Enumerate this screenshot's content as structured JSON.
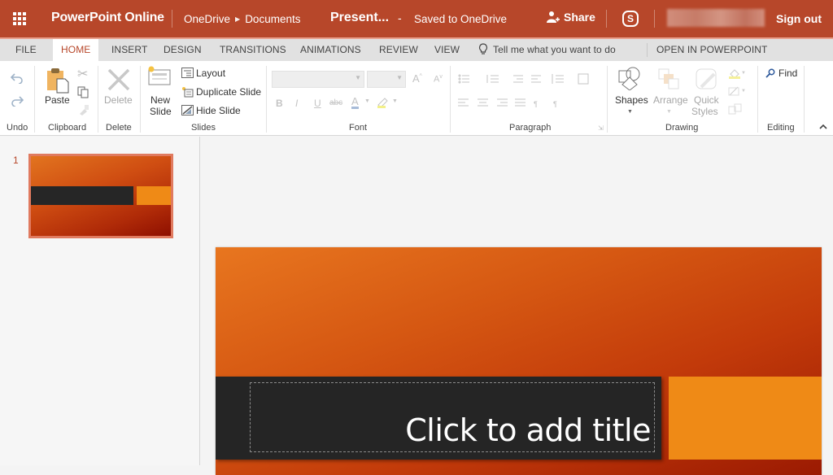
{
  "header": {
    "app_name": "PowerPoint Online",
    "breadcrumb": [
      "OneDrive",
      "Documents"
    ],
    "doc_title": "Present...",
    "separator": "-",
    "save_status": "Saved to OneDrive",
    "share_label": "Share",
    "skype_glyph": "S",
    "sign_out_label": "Sign out",
    "brand_color": "#b7472a"
  },
  "tabs": {
    "items": [
      "FILE",
      "HOME",
      "INSERT",
      "DESIGN",
      "TRANSITIONS",
      "ANIMATIONS",
      "REVIEW",
      "VIEW"
    ],
    "active": "HOME",
    "tell_me": "Tell me what you want to do",
    "open_in": "OPEN IN POWERPOINT"
  },
  "ribbon": {
    "groups": {
      "undo": "Undo",
      "clipboard": "Clipboard",
      "delete": "Delete",
      "slides": "Slides",
      "font": "Font",
      "paragraph": "Paragraph",
      "drawing": "Drawing",
      "editing": "Editing"
    },
    "buttons": {
      "paste": "Paste",
      "delete": "Delete",
      "new_slide_1": "New",
      "new_slide_2": "Slide",
      "layout": "Layout",
      "duplicate_slide": "Duplicate Slide",
      "hide_slide": "Hide Slide",
      "shapes": "Shapes",
      "arrange": "Arrange",
      "quick_styles_1": "Quick",
      "quick_styles_2": "Styles",
      "find": "Find"
    },
    "font": {
      "font_name": "",
      "font_size": "",
      "bold": "B",
      "italic": "I",
      "underline": "U",
      "strikethrough": "abc",
      "font_color": "A"
    }
  },
  "slides_panel": {
    "slides": [
      {
        "number": "1"
      }
    ],
    "selected_border_color": "#e07a5f"
  },
  "slide": {
    "title_placeholder": "Click to add title",
    "colors": {
      "bar": "#252525",
      "accent": "#ef8a16"
    }
  }
}
